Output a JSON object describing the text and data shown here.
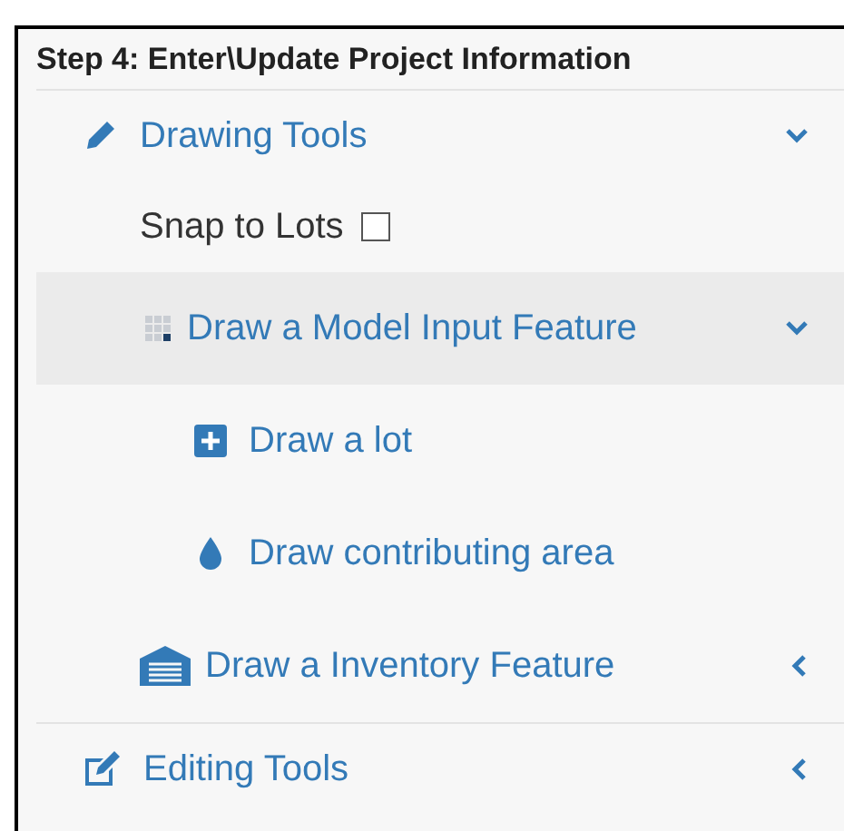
{
  "title": "Step 4: Enter\\Update Project Information",
  "sections": [
    {
      "label": "Drawing Tools",
      "expanded": true,
      "children": [
        {
          "kind": "checkbox",
          "label": "Snap to Lots",
          "checked": false
        },
        {
          "kind": "group",
          "label": "Draw a Model Input Feature",
          "expanded": true,
          "selected": true,
          "children": [
            {
              "label": "Draw a lot"
            },
            {
              "label": "Draw contributing area"
            }
          ]
        },
        {
          "kind": "group",
          "label": "Draw a Inventory Feature",
          "expanded": false,
          "selected": false
        }
      ]
    },
    {
      "label": "Editing Tools",
      "expanded": false
    }
  ]
}
